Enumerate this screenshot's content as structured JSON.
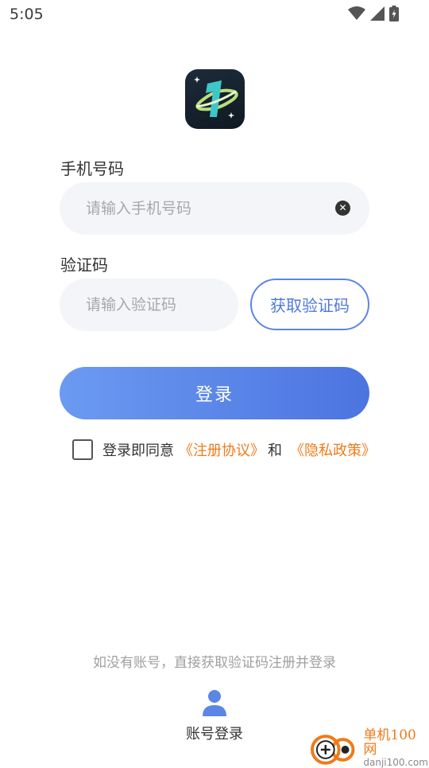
{
  "status_bar": {
    "time": "5:05"
  },
  "form": {
    "phone_label": "手机号码",
    "phone_placeholder": "请输入手机号码",
    "code_label": "验证码",
    "code_placeholder": "请输入验证码",
    "get_code_button": "获取验证码",
    "login_button": "登录"
  },
  "agreement": {
    "prefix": "登录即同意",
    "terms": "《注册协议》",
    "and": "和",
    "privacy": "《隐私政策》"
  },
  "footer": {
    "hint": "如没有账号，直接获取验证码注册并登录",
    "account_login": "账号登录"
  },
  "watermark": {
    "site_name": "单机100网",
    "site_url": "danji100.com"
  },
  "colors": {
    "accent": "#4f79d9",
    "link": "#ef7a1a",
    "input_bg": "#f4f5f8"
  }
}
